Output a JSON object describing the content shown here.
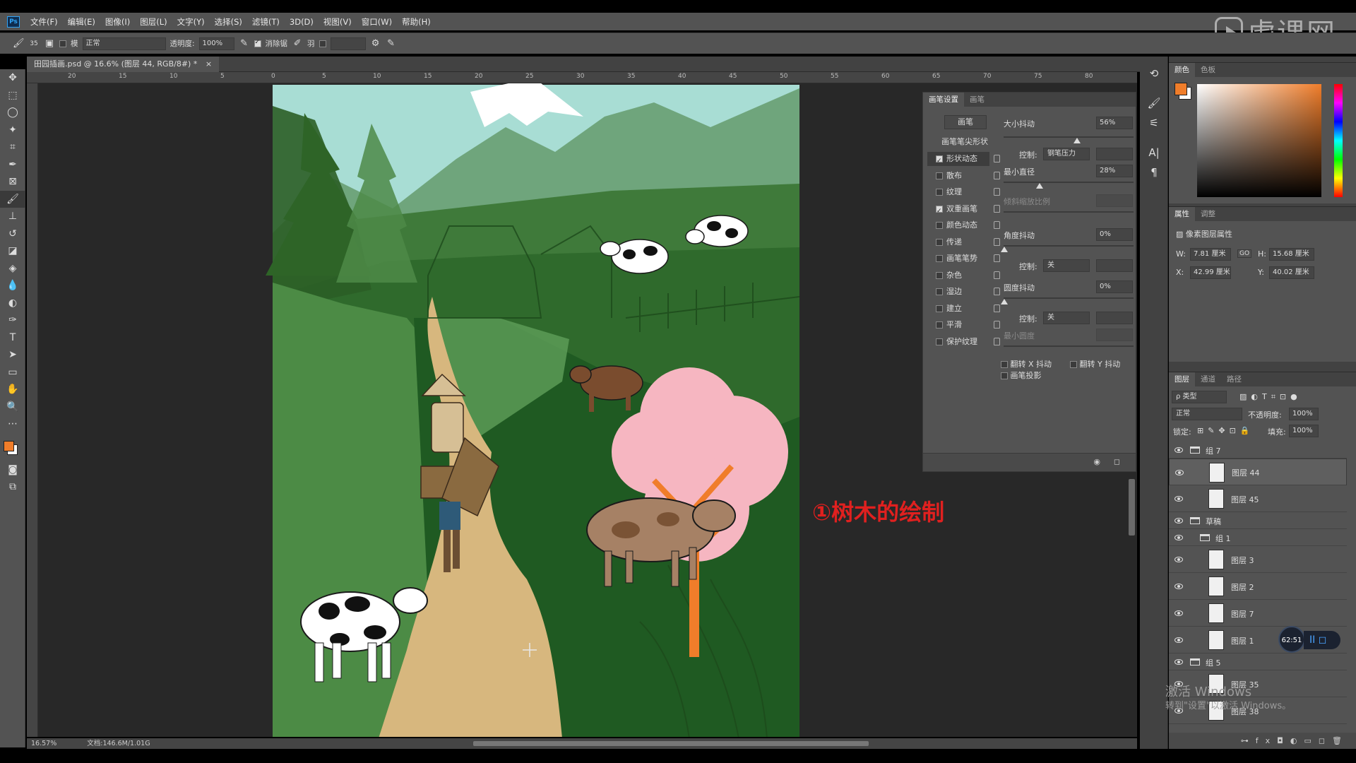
{
  "app": {
    "logo": "Ps",
    "menu": [
      "文件(F)",
      "编辑(E)",
      "图像(I)",
      "图层(L)",
      "文字(Y)",
      "选择(S)",
      "滤镜(T)",
      "3D(D)",
      "视图(V)",
      "窗口(W)",
      "帮助(H)"
    ]
  },
  "watermark": {
    "text": "虎课网"
  },
  "options": {
    "brush_size": "35",
    "mode_label": "模",
    "mode_value": "正常",
    "opacity_label": "透明度:",
    "opacity_value": "100%",
    "smooth_label": "消除锯",
    "flow_label": "羽"
  },
  "document": {
    "tab_title": "田园插画.psd @ 16.6% (图层 44, RGB/8#) *",
    "close": "×",
    "zoom": "16.57%",
    "doc_info": "文档:146.6M/1.01G"
  },
  "ruler": {
    "h_labels": [
      "20",
      "15",
      "10",
      "5",
      "0",
      "5",
      "10",
      "15",
      "20",
      "25",
      "30",
      "35",
      "40",
      "45",
      "50",
      "55",
      "60",
      "65",
      "70",
      "75",
      "80"
    ]
  },
  "annotation": "①树木的绘制",
  "brush_panel": {
    "tabs": [
      "画笔设置",
      "画笔"
    ],
    "btn_brush": "画笔",
    "btn_tip_shape": "画笔笔尖形状",
    "items": [
      {
        "label": "形状动态",
        "checked": true
      },
      {
        "label": "散布",
        "checked": false
      },
      {
        "label": "纹理",
        "checked": false
      },
      {
        "label": "双重画笔",
        "checked": true
      },
      {
        "label": "颜色动态",
        "checked": false
      },
      {
        "label": "传递",
        "checked": false
      },
      {
        "label": "画笔笔势",
        "checked": false
      },
      {
        "label": "杂色",
        "checked": false
      },
      {
        "label": "湿边",
        "checked": false
      },
      {
        "label": "建立",
        "checked": false
      },
      {
        "label": "平滑",
        "checked": false
      },
      {
        "label": "保护纹理",
        "checked": false
      }
    ],
    "size_jitter_label": "大小抖动",
    "size_jitter_value": "56%",
    "control_label": "控制:",
    "control_pen": "钢笔压力",
    "min_diameter_label": "最小直径",
    "min_diameter_value": "28%",
    "tilt_scale_label": "倾斜缩放比例",
    "angle_jitter_label": "角度抖动",
    "angle_jitter_value": "0%",
    "control_off": "关",
    "roundness_jitter_label": "圆度抖动",
    "roundness_jitter_value": "0%",
    "min_roundness_label": "最小圆度",
    "flip_x": "翻转 X 抖动",
    "flip_y": "翻转 Y 抖动",
    "brush_projection": "画笔投影"
  },
  "color_panel": {
    "tabs": [
      "颜色",
      "色板"
    ],
    "fg": "#f07d2a",
    "bg": "#ffffff"
  },
  "props_panel": {
    "tabs": [
      "属性",
      "调整"
    ],
    "title": "像素图层属性",
    "w_label": "W:",
    "w": "7.81 厘米",
    "h_label": "H:",
    "h": "15.68 厘米",
    "x_label": "X:",
    "x": "42.99 厘米",
    "y_label": "Y:",
    "y": "40.02 厘米",
    "link": "GO"
  },
  "layers_panel": {
    "tabs": [
      "图层",
      "通道",
      "路径"
    ],
    "filter": "ρ 类型",
    "blend": "正常",
    "opacity_label": "不透明度:",
    "opacity": "100%",
    "lock_label": "锁定:",
    "fill_label": "填充:",
    "fill": "100%",
    "layers": [
      {
        "name": "组 7",
        "type": "group",
        "indent": 0
      },
      {
        "name": "图层 44",
        "type": "layer",
        "indent": 1,
        "selected": true
      },
      {
        "name": "图层 45",
        "type": "layer",
        "indent": 1
      },
      {
        "name": "草稿",
        "type": "group",
        "indent": 0
      },
      {
        "name": "组 1",
        "type": "group",
        "indent": 1
      },
      {
        "name": "图层 3",
        "type": "layer",
        "indent": 1
      },
      {
        "name": "图层 2",
        "type": "layer",
        "indent": 1
      },
      {
        "name": "图层 7",
        "type": "layer",
        "indent": 1
      },
      {
        "name": "图层 1",
        "type": "layer",
        "indent": 1
      },
      {
        "name": "组 5",
        "type": "group",
        "indent": 0
      },
      {
        "name": "图层 35",
        "type": "layer",
        "indent": 1
      },
      {
        "name": "图层 38",
        "type": "layer",
        "indent": 1
      }
    ],
    "footer_icons": [
      "link-icon",
      "fx-icon",
      "mask-icon",
      "adjust-icon",
      "folder-icon",
      "new-layer-icon",
      "trash-icon"
    ]
  },
  "timer": "62:51",
  "play": "II ◻",
  "windows_activation": {
    "line1": "激活 Windows",
    "line2": "转到\"设置\"以激活 Windows。"
  }
}
